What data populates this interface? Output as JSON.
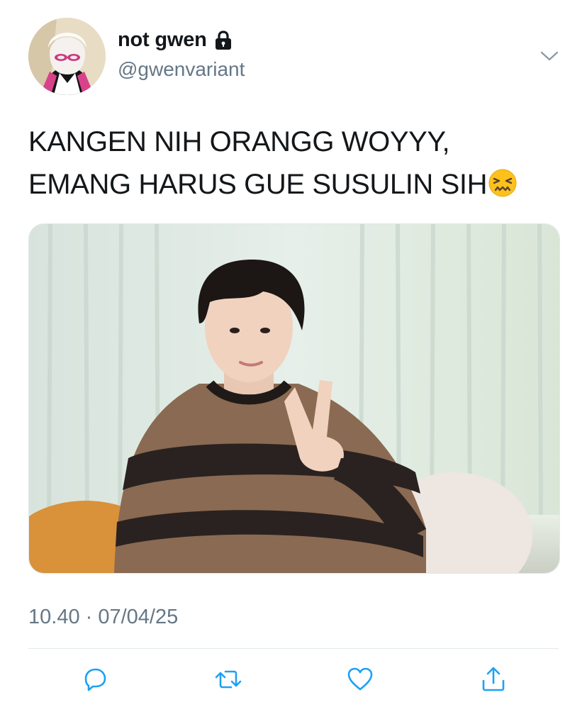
{
  "user": {
    "display_name": "not gwen",
    "handle": "@gwenvariant",
    "protected_icon": "lock-icon",
    "avatar_icon": "spider-gwen-avatar"
  },
  "tweet": {
    "line1": "KANGEN NIH ORANGG WOYYY,",
    "line2": "EMANG HARUS GUE SUSULIN SIH",
    "emoji_icon": "confounded-face-emoji",
    "media_icon": "photo-person-peace-sign",
    "timestamp": "10.40 · 07/04/25"
  },
  "actions": [
    {
      "icon": "reply-icon"
    },
    {
      "icon": "retweet-icon"
    },
    {
      "icon": "like-icon"
    },
    {
      "icon": "share-icon"
    }
  ],
  "colors": {
    "text": "#14171a",
    "secondary": "#657786",
    "icon": "#1da1f2",
    "divider": "#e1e8ed"
  }
}
